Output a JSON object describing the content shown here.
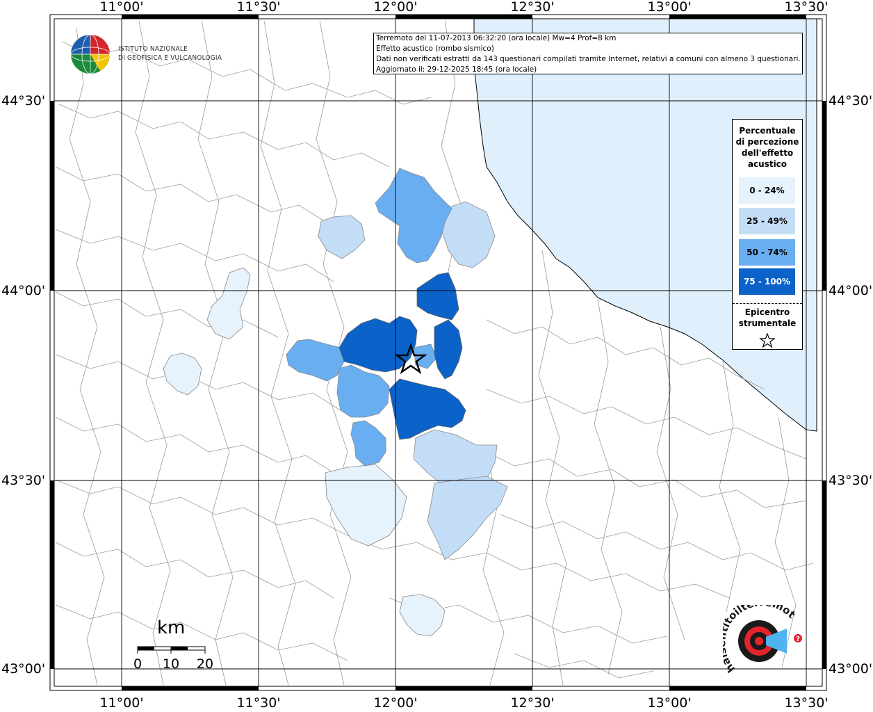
{
  "map": {
    "lon_labels": [
      "11°00'",
      "11°30'",
      "12°00'",
      "12°30'",
      "13°00'",
      "13°30'"
    ],
    "lat_labels": [
      "44°30'",
      "44°00'",
      "43°30'",
      "43°00'"
    ],
    "colors": {
      "sea": "#dff0fc",
      "class0": "#e6f2fc",
      "class1": "#c4ddf7",
      "class2": "#6aaef2",
      "class3": "#0b62c8",
      "borders": "#9a9a9a"
    }
  },
  "info": {
    "line1": "Terremoto del 11-07-2013 06:32:20 (ora locale) Mw=4 Prof=8 km",
    "line2": "Effetto acustico (rombo sismico)",
    "line3": "Dati non verificati estratti da 143 questionari compilati tramite Internet, relativi a comuni con almeno 3 questionari.",
    "line4": "Aggiornato il: 29-12-2025 18:45 (ora locale)"
  },
  "logo": {
    "line1": "ISTITUTO NAZIONALE",
    "line2": "DI GEOFISICA E VULCANOLOGIA"
  },
  "legend": {
    "title_lines": [
      "Percentuale",
      "di percezione",
      "dell'effetto",
      "acustico"
    ],
    "classes": [
      "0 - 24%",
      "25 - 49%",
      "50 - 74%",
      "75 - 100%"
    ],
    "epicenter_lines": [
      "Epicentro",
      "strumentale"
    ]
  },
  "scale": {
    "unit": "km",
    "ticks": [
      "0",
      "10",
      "20"
    ]
  },
  "brand": {
    "name": "haisentitoilterremoto.it"
  }
}
